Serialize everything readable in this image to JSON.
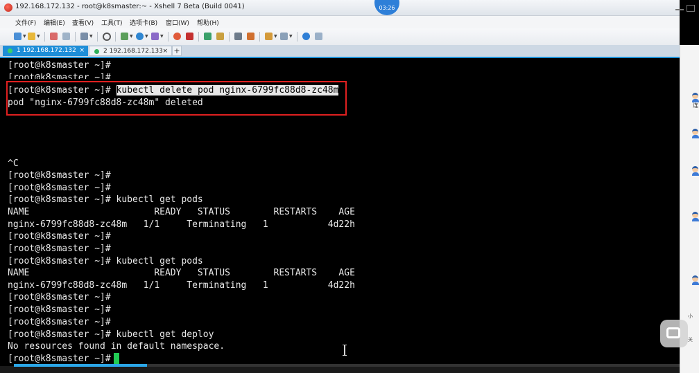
{
  "window": {
    "title": "192.168.172.132 - root@k8smaster:~ - Xshell 7 Beta (Build 0041)",
    "clock": "03:26"
  },
  "menu": [
    "文件(F)",
    "编辑(E)",
    "查看(V)",
    "工具(T)",
    "选项卡(B)",
    "窗口(W)",
    "帮助(H)"
  ],
  "tabs": [
    {
      "label": "1 192.168.172.132",
      "active": true
    },
    {
      "label": "2 192.168.172.133",
      "active": false
    }
  ],
  "terminal": {
    "lines": [
      "[root@k8smaster ~]#",
      "[root@k8smaster ~]#",
      "[root@k8smaster ~]# ",
      "pod \"nginx-6799fc88d8-zc48m\" deleted",
      "",
      "",
      "",
      "",
      "^C",
      "[root@k8smaster ~]#",
      "[root@k8smaster ~]#",
      "[root@k8smaster ~]# kubectl get pods",
      "NAME                       READY   STATUS        RESTARTS    AGE",
      "nginx-6799fc88d8-zc48m   1/1     Terminating   1           4d22h",
      "[root@k8smaster ~]#",
      "[root@k8smaster ~]#",
      "[root@k8smaster ~]# kubectl get pods",
      "NAME                       READY   STATUS        RESTARTS    AGE",
      "nginx-6799fc88d8-zc48m   1/1     Terminating   1           4d22h",
      "[root@k8smaster ~]#",
      "[root@k8smaster ~]#",
      "[root@k8smaster ~]#",
      "[root@k8smaster ~]# kubectl get deploy",
      "No resources found in default namespace.",
      "[root@k8smaster ~]# "
    ],
    "highlighted_command": "kubectl delete pod nginx-6799fc88d8-zc48m"
  },
  "right_panel": {
    "label": "连",
    "small_1": "小",
    "small_2": "关"
  },
  "playback": {
    "progress_fraction": 0.2
  },
  "colors": {
    "annotation_box": "#e02020",
    "cursor": "#22cc55",
    "active_tab": "#1e8ed8"
  }
}
